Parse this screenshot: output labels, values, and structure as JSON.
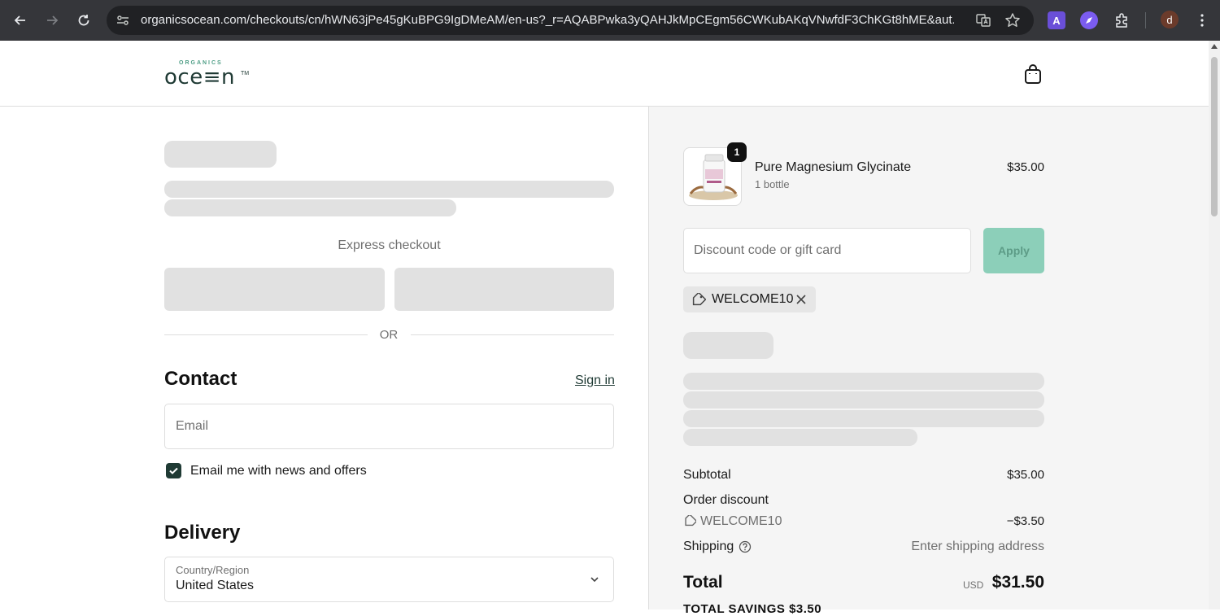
{
  "browser": {
    "url": "organicsocean.com/checkouts/cn/hWN63jPe45gKuBPG9IgDMeAM/en-us?_r=AQABPwka3yQAHJkMpCEgm56CWKubAKqVNwfdF3ChKGt8hME&aut...",
    "profile_initial": "d"
  },
  "header": {
    "logo_small": "ORGANICS",
    "logo_main": "oce≡n",
    "logo_tm": "TM"
  },
  "checkout": {
    "express_label": "Express checkout",
    "or_label": "OR",
    "contact_heading": "Contact",
    "sign_in": "Sign in",
    "email_placeholder": "Email",
    "newsletter_label": "Email me with news and offers",
    "newsletter_checked": true,
    "delivery_heading": "Delivery",
    "country_label": "Country/Region",
    "country_value": "United States"
  },
  "summary": {
    "item": {
      "name": "Pure Magnesium Glycinate",
      "variant": "1 bottle",
      "price": "$35.00",
      "quantity": "1"
    },
    "discount_placeholder": "Discount code or gift card",
    "apply_label": "Apply",
    "applied_code": "WELCOME10",
    "subtotal_label": "Subtotal",
    "subtotal_value": "$35.00",
    "order_discount_label": "Order discount",
    "discount_code": "WELCOME10",
    "discount_value": "−$3.50",
    "shipping_label": "Shipping",
    "shipping_value": "Enter shipping address",
    "total_label": "Total",
    "total_currency": "USD",
    "total_value": "$31.50",
    "savings_label": "TOTAL SAVINGS $3.50"
  },
  "colors": {
    "brand": "#1f3a34",
    "apply_button": "#8ccfb9",
    "summary_bg": "#f5f5f5",
    "skeleton": "#e1e1e1"
  }
}
